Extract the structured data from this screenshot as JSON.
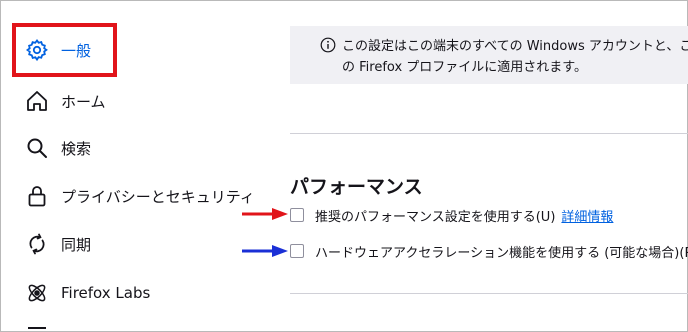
{
  "sidebar": {
    "items": [
      {
        "label": "一般",
        "icon": "gear-icon"
      },
      {
        "label": "ホーム",
        "icon": "home-icon"
      },
      {
        "label": "検索",
        "icon": "search-icon"
      },
      {
        "label": "プライバシーとセキュリティ",
        "icon": "lock-icon"
      },
      {
        "label": "同期",
        "icon": "sync-icon"
      },
      {
        "label": "Firefox Labs",
        "icon": "atom-icon"
      }
    ]
  },
  "info": {
    "line1": "この設定はこの端末のすべての Windows アカウントと、この",
    "line2": "の Firefox プロファイルに適用されます。",
    "icon": "info-icon"
  },
  "performance": {
    "title": "パフォーマンス",
    "recommended_label": "推奨のパフォーマンス設定を使用する(U)",
    "learn_more": "詳細情報",
    "hw_accel_label": "ハードウェアアクセラレーション機能を使用する (可能な場合)(R)"
  },
  "colors": {
    "accent": "#0061e0",
    "highlight_border": "#e1141a",
    "arrow_red": "#e1141a",
    "arrow_blue": "#1a2fd6"
  }
}
